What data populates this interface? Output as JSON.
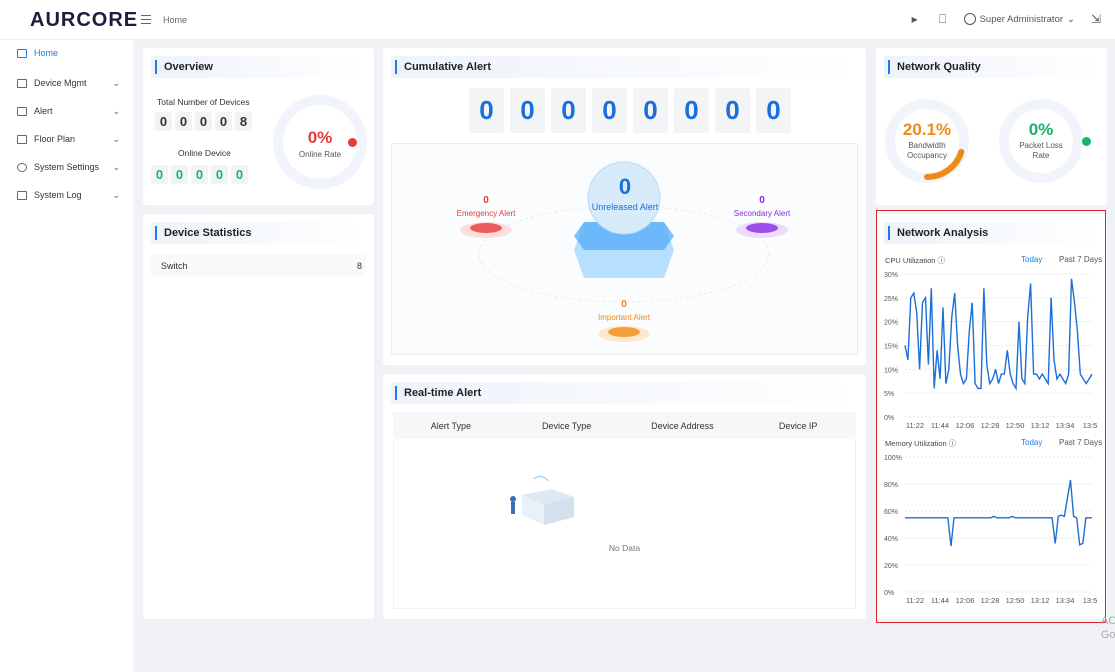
{
  "app": {
    "logo": "AURCORE",
    "breadcrumb": "Home"
  },
  "header": {
    "user": "Super Administrator",
    "icons": [
      "speaker-icon",
      "lock-icon",
      "user-circle-icon",
      "fullscreen-icon"
    ]
  },
  "sidebar": {
    "items": [
      {
        "label": "Home",
        "icon": "home-icon",
        "active": true
      },
      {
        "label": "Device Mgmt",
        "icon": "monitor-icon"
      },
      {
        "label": "Alert",
        "icon": "alarm-icon"
      },
      {
        "label": "Floor Plan",
        "icon": "floor-plan-icon"
      },
      {
        "label": "System Settings",
        "icon": "gear-icon"
      },
      {
        "label": "System Log",
        "icon": "log-icon"
      }
    ]
  },
  "overview": {
    "title": "Overview",
    "total_label": "Total Number of Devices",
    "total_digits": [
      "0",
      "0",
      "0",
      "0",
      "8"
    ],
    "online_label": "Online Device",
    "online_digits": [
      "0",
      "0",
      "0",
      "0",
      "0"
    ],
    "online_rate": "0%",
    "online_rate_label": "Online Rate"
  },
  "device_statistics": {
    "title": "Device Statistics",
    "rows": [
      {
        "name": "Switch",
        "value": "8"
      }
    ]
  },
  "cumulative_alert": {
    "title": "Cumulative Alert",
    "digits": [
      "0",
      "0",
      "0",
      "0",
      "0",
      "0",
      "0",
      "0"
    ],
    "unreleased": {
      "value": "0",
      "label": "Unreleased Alert"
    },
    "emergency": {
      "value": "0",
      "label": "Emergency Alert",
      "color": "#e63b3b"
    },
    "secondary": {
      "value": "0",
      "label": "Secondary Alert",
      "color": "#8a2be2"
    },
    "important": {
      "value": "0",
      "label": "Important Alert",
      "color": "#f08a16"
    }
  },
  "realtime_alert": {
    "title": "Real-time Alert",
    "columns": [
      "Alert Type",
      "Device Type",
      "Device Address",
      "Device IP"
    ],
    "empty_text": "No Data"
  },
  "network_quality": {
    "title": "Network Quality",
    "bandwidth": {
      "value": "20.1%",
      "label": "Bandwidth Occupancy",
      "fill": 0.201,
      "color": "#f08a16"
    },
    "packet_loss": {
      "value": "0%",
      "label": "Packet Loss Rate",
      "color": "#19b26b"
    }
  },
  "network_analysis": {
    "title": "Network Analysis",
    "cpu": {
      "label": "CPU Utilization",
      "today": "Today",
      "past": "Past 7 Days"
    },
    "memory": {
      "label": "Memory Utilization",
      "today": "Today",
      "past": "Past 7 Days"
    }
  },
  "watermark": {
    "line1": "AC",
    "line2": "Go"
  },
  "chart_data": [
    {
      "type": "line",
      "title": "CPU Utilization",
      "x": [
        "11:22",
        "11:44",
        "12:06",
        "12:28",
        "12:50",
        "13:12",
        "13:34",
        "13:5"
      ],
      "yticks": [
        "0%",
        "5%",
        "10%",
        "15%",
        "20%",
        "25%",
        "30%"
      ],
      "ylim": [
        0,
        30
      ],
      "grid": true,
      "series": [
        {
          "values": [
            15,
            12,
            25,
            26,
            22,
            10,
            24,
            25,
            11,
            27,
            6,
            14,
            8,
            23,
            7,
            10,
            21,
            26,
            15,
            9,
            7,
            8,
            18,
            24,
            7,
            6,
            6,
            27,
            11,
            7,
            8,
            10,
            7,
            9,
            9,
            14,
            9,
            7,
            6,
            20,
            8,
            7,
            21,
            28,
            9,
            9,
            8,
            9,
            8,
            7,
            25,
            12,
            8,
            9,
            8,
            7,
            9,
            29,
            24,
            18,
            9,
            8,
            7,
            8,
            9
          ]
        }
      ]
    },
    {
      "type": "line",
      "title": "Memory Utilization",
      "x": [
        "11:22",
        "11:44",
        "12:06",
        "12:28",
        "12:50",
        "13:12",
        "13:34",
        "13:5"
      ],
      "yticks": [
        "0%",
        "20%",
        "40%",
        "60%",
        "80%",
        "100%"
      ],
      "ylim": [
        0,
        100
      ],
      "grid": true,
      "series": [
        {
          "values": [
            55,
            55,
            55,
            55,
            55,
            55,
            55,
            55,
            55,
            55,
            55,
            55,
            55,
            55,
            55,
            34,
            55,
            55,
            55,
            55,
            55,
            55,
            55,
            55,
            55,
            55,
            55,
            55,
            55,
            56,
            55,
            55,
            55,
            55,
            55,
            56,
            55,
            55,
            55,
            55,
            55,
            55,
            55,
            55,
            55,
            55,
            55,
            55,
            55,
            36,
            56,
            57,
            56,
            70,
            83,
            56,
            55,
            35,
            36,
            55,
            55,
            55
          ]
        }
      ]
    }
  ]
}
